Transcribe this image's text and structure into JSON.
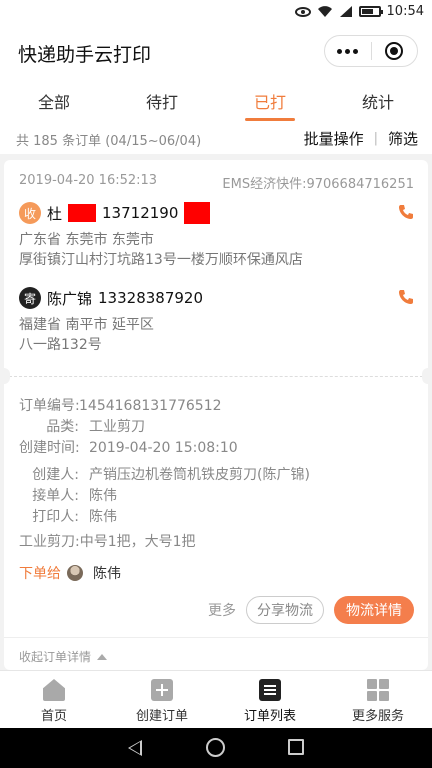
{
  "status_bar": {
    "time": "10:54"
  },
  "app": {
    "title": "快递助手云打印"
  },
  "tabs": [
    {
      "label": "全部"
    },
    {
      "label": "待打"
    },
    {
      "label": "已打"
    },
    {
      "label": "统计"
    }
  ],
  "summary": {
    "count_text": "共 185 条订单 (04/15~06/04)",
    "batch_label": "批量操作",
    "separator": "|",
    "filter_label": "筛选"
  },
  "order": {
    "datetime": "2019-04-20 16:52:13",
    "express": "EMS经济快件:9706684716251",
    "receiver": {
      "badge": "收",
      "name": "杜",
      "phone": "13712190",
      "region": "广东省 东莞市 东莞市",
      "address": "厚街镇汀山村汀坑路13号一楼万顺环保通风店"
    },
    "sender": {
      "badge": "寄",
      "name": "陈广锦",
      "phone": "13328387920",
      "region": "福建省 南平市 延平区",
      "address": "八一路132号"
    },
    "details": {
      "order_no_label": "订单编号:",
      "order_no": "1454168131776512",
      "category_label": "品类:",
      "category": "工业剪刀",
      "created_label": "创建时间:",
      "created": "2019-04-20 15:08:10",
      "creator_label": "创建人:",
      "creator": "产销压边机卷筒机铁皮剪刀(陈广锦)",
      "taker_label": "接单人:",
      "taker": "陈伟",
      "printer_label": "打印人:",
      "printer": "陈伟",
      "goods": "工业剪刀:中号1把，大号1把"
    },
    "assigned_label": "下单给",
    "assigned_to": "陈伟",
    "actions": {
      "more": "更多",
      "share": "分享物流",
      "logistics": "物流详情"
    },
    "collapse_label": "收起订单详情"
  },
  "bottom_nav": [
    {
      "label": "首页",
      "icon": "home-icon"
    },
    {
      "label": "创建订单",
      "icon": "add-icon"
    },
    {
      "label": "订单列表",
      "icon": "list-icon"
    },
    {
      "label": "更多服务",
      "icon": "grid-icon"
    }
  ],
  "colors": {
    "accent": "#f07c3c",
    "button": "#f47e4c"
  }
}
